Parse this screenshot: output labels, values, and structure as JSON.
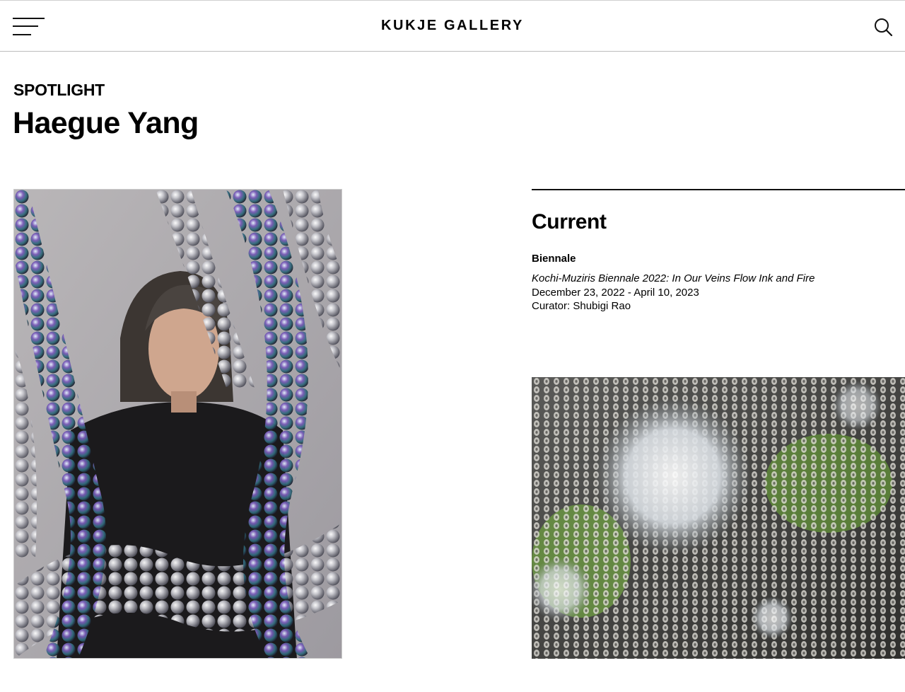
{
  "header": {
    "brand": "KUKJE GALLERY",
    "menu_icon": "hamburger-menu-icon",
    "search_icon": "search-icon"
  },
  "spotlight": {
    "section_label": "SPOTLIGHT",
    "artist_name": "Haegue Yang"
  },
  "current": {
    "heading": "Current",
    "category": "Biennale",
    "exhibition_title": "Kochi-Muziris Biennale 2022: In Our Veins Flow Ink and Fire",
    "dates": "December 23, 2022 - April 10, 2023",
    "curator": "Curator: Shubigi Rao"
  },
  "colors": {
    "text": "#000000",
    "background": "#ffffff",
    "divider": "#bdbdbd"
  }
}
